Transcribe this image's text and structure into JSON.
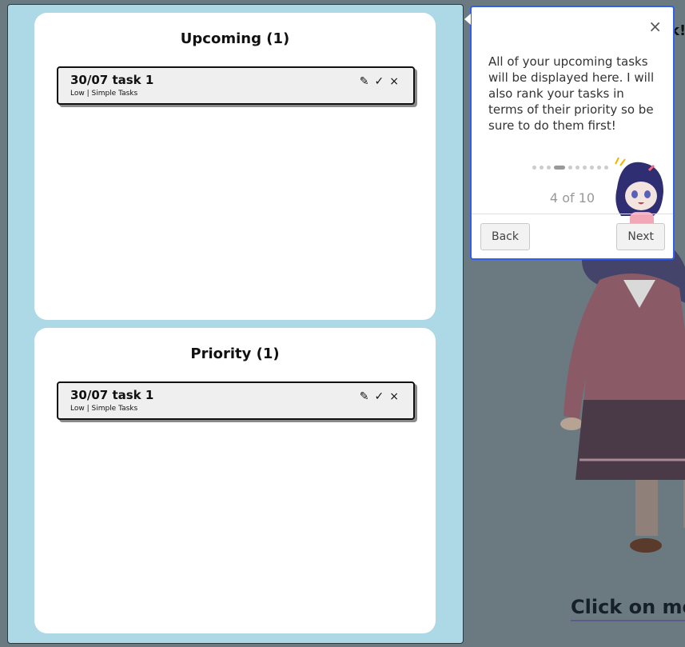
{
  "upcoming": {
    "title": "Upcoming (1)",
    "task": {
      "title": "30/07 task 1",
      "subtitle": "Low | Simple Tasks"
    }
  },
  "priority": {
    "title": "Priority (1)",
    "task": {
      "title": "30/07 task 1",
      "subtitle": "Low | Simple Tasks"
    }
  },
  "task_actions": {
    "edit_icon": "✎",
    "done_icon": "✓",
    "delete_icon": "×"
  },
  "right": {
    "peek_text": "k!",
    "click_me": "Click on me"
  },
  "tour": {
    "close_icon": "×",
    "message": "All of your upcoming tasks will be displayed here. I will also rank your tasks in terms of their priority so be sure to do them first!",
    "progress": "4 of 10",
    "current_step": 4,
    "total_steps": 10,
    "back_label": "Back",
    "next_label": "Next"
  },
  "colors": {
    "panel_bg": "#add8e6",
    "page_bg": "#6b7a80",
    "popup_border": "#2f5ff0"
  }
}
